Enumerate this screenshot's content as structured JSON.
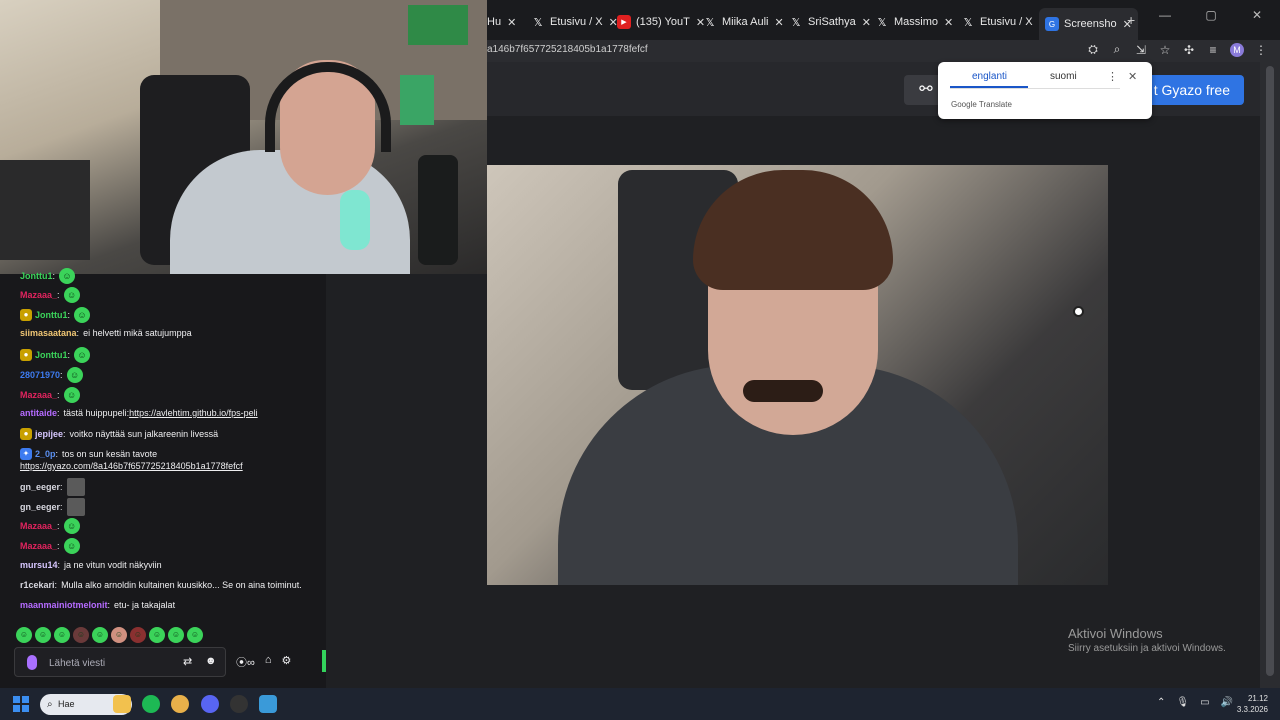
{
  "browser": {
    "tabs": [
      {
        "label": "Hu",
        "icon": "tab-icon"
      },
      {
        "label": "Etusivu / X",
        "icon": "x-icon"
      },
      {
        "label": "(135) YouT",
        "icon": "youtube-icon"
      },
      {
        "label": "Miika Auli",
        "icon": "x-icon"
      },
      {
        "label": "SriSathya",
        "icon": "x-icon"
      },
      {
        "label": "Massimo",
        "icon": "x-icon"
      },
      {
        "label": "Etusivu / X",
        "icon": "x-icon"
      },
      {
        "label": "Screensho",
        "icon": "gyazo-icon"
      }
    ],
    "url_fragment": "a146b7f657725218405b1a1778fefcf",
    "avatar_letter": "M",
    "new_tab_glyph": "+"
  },
  "gyazo": {
    "cta_label": "t Gyazo free",
    "accent": "#2f74e3"
  },
  "translate_popup": {
    "tab_source": "englanti",
    "tab_target": "suomi",
    "brand": "Google Translate"
  },
  "watermark": {
    "title": "Aktivoi Windows",
    "subtitle": "Siirry asetuksiin ja aktivoi Windows."
  },
  "chat": {
    "messages": [
      {
        "user": "Jonttu1",
        "color": "#3bd35a",
        "text": "",
        "emote": true
      },
      {
        "user": "Mazaaa_",
        "color": "#e0245e",
        "text": "",
        "emote": true
      },
      {
        "user": "Jonttu1",
        "color": "#3bd35a",
        "text": "",
        "emote": true
      },
      {
        "user": "siimasaatana",
        "color": "#f0c674",
        "text": "ei helvetti mikä satujumppa"
      },
      {
        "user": "Jonttu1",
        "color": "#3bd35a",
        "text": "",
        "emote": true
      },
      {
        "user": "28071970",
        "color": "#3d7bf0",
        "text": "",
        "emote": true
      },
      {
        "user": "Mazaaa_",
        "color": "#e0245e",
        "text": "",
        "emote": true
      },
      {
        "user": "antitaide",
        "color": "#b56bff",
        "text": "tästä huippupeli: ",
        "link": "https://avlehtim.github.io/fps-peli"
      },
      {
        "user": "jepijee",
        "color": "#d7c7ff",
        "text": "voitko näyttää sun jalkareenin livessä"
      },
      {
        "user": "2_0p",
        "color": "#5a8ff0",
        "text": "tos on sun kesän tavote"
      },
      {
        "user": "gn_eeger",
        "color": "#d7d7df",
        "text": "",
        "image": true
      },
      {
        "user": "gn_eeger",
        "color": "#d7d7df",
        "text": "",
        "image": true
      },
      {
        "user": "Mazaaa_",
        "color": "#e0245e",
        "text": "",
        "emote": true
      },
      {
        "user": "Mazaaa_",
        "color": "#e0245e",
        "text": "",
        "emote": true
      },
      {
        "user": "mursu14",
        "color": "#d7c7ff",
        "text": "ja ne vitun vodit näkyviin"
      },
      {
        "user": "r1cekari",
        "color": "#d7d7df",
        "text": "Mulla alko arnoldin kultainen kuusikko... Se on aina toiminut."
      },
      {
        "user": "maanmainiotmelonit",
        "color": "#b56bff",
        "text": "etu- ja takajalat"
      }
    ],
    "link_line": "https://gyazo.com/8a146b7f657725218405b1a1778fefcf",
    "input_placeholder": "Lähetä viesti"
  },
  "taskbar": {
    "search_label": "Hae",
    "time": "21.12",
    "date": "3.3.2026"
  }
}
